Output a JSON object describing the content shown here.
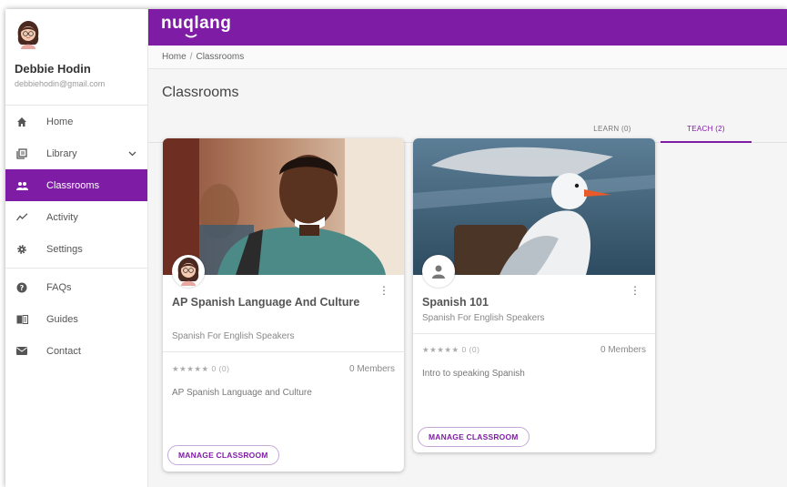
{
  "brand": {
    "logo_text": "nuqlang",
    "accent": "#7f1ca6"
  },
  "user": {
    "name": "Debbie Hodin",
    "email": "debbiehodin@gmail.com"
  },
  "sidebar": {
    "items": [
      {
        "label": "Home",
        "icon": "home-icon"
      },
      {
        "label": "Library",
        "icon": "library-icon"
      },
      {
        "label": "Classrooms",
        "icon": "people-icon",
        "active": true
      },
      {
        "label": "Activity",
        "icon": "activity-icon"
      },
      {
        "label": "Settings",
        "icon": "gear-icon"
      },
      {
        "label": "FAQs",
        "icon": "help-icon"
      },
      {
        "label": "Guides",
        "icon": "book-icon"
      },
      {
        "label": "Contact",
        "icon": "mail-icon"
      }
    ]
  },
  "breadcrumb": {
    "home": "Home",
    "separator": "/",
    "current": "Classrooms"
  },
  "page": {
    "title": "Classrooms"
  },
  "tabs": {
    "learn": "LEARN (0)",
    "teach": "TEACH (2)"
  },
  "classrooms": [
    {
      "title": "AP Spanish Language And Culture",
      "subtitle": "Spanish For English Speakers",
      "rating": "★★★★★ 0 (0)",
      "members": "0 Members",
      "description": "AP Spanish Language and Culture",
      "button": "MANAGE CLASSROOM"
    },
    {
      "title": "Spanish 101",
      "subtitle": "Spanish For English Speakers",
      "rating": "★★★★★ 0 (0)",
      "members": "0 Members",
      "description": "Intro to speaking Spanish",
      "button": "MANAGE CLASSROOM"
    }
  ]
}
